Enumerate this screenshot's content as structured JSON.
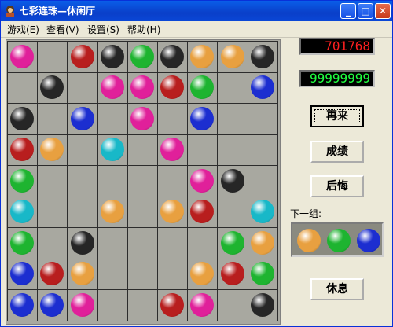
{
  "window": {
    "title": "七彩连珠—休闲厅"
  },
  "titlebar": {
    "minimize_icon": "minimize-icon",
    "maximize_icon": "maximize-icon",
    "close_icon": "close-icon"
  },
  "menu": [
    {
      "label": "游戏(E)"
    },
    {
      "label": "查看(V)"
    },
    {
      "label": "设置(S)"
    },
    {
      "label": "帮助(H)"
    }
  ],
  "colors": {
    "M": "#e0209a",
    "R": "#b81e1e",
    "K": "#262626",
    "G": "#1eb430",
    "O": "#e8a040",
    "B": "#1c2ed0",
    "C": "#18b8c8"
  },
  "board": {
    "rows": 9,
    "cols": 9,
    "cells": [
      [
        "M",
        "",
        "R",
        "K",
        "G",
        "K",
        "O",
        "O",
        "K"
      ],
      [
        "",
        "K",
        "",
        "M",
        "M",
        "R",
        "G",
        "",
        "B"
      ],
      [
        "K",
        "",
        "B",
        "",
        "M",
        "",
        "B",
        "",
        ""
      ],
      [
        "R",
        "O",
        "",
        "C",
        "",
        "M",
        "",
        "",
        ""
      ],
      [
        "G",
        "",
        "",
        "",
        "",
        "",
        "M",
        "K",
        ""
      ],
      [
        "C",
        "",
        "",
        "O",
        "",
        "O",
        "R",
        "",
        "C"
      ],
      [
        "G",
        "",
        "K",
        "",
        "",
        "",
        "",
        "G",
        "O"
      ],
      [
        "B",
        "R",
        "O",
        "",
        "",
        "",
        "O",
        "R",
        "G"
      ],
      [
        "B",
        "B",
        "M",
        "",
        "",
        "R",
        "M",
        "",
        "K"
      ]
    ]
  },
  "score": {
    "current": "701768",
    "best": "99999999"
  },
  "buttons": {
    "restart": "再来",
    "scores": "成绩",
    "undo": "后悔",
    "rest": "休息"
  },
  "next": {
    "label": "下一组:",
    "balls": [
      "O",
      "G",
      "B"
    ]
  }
}
